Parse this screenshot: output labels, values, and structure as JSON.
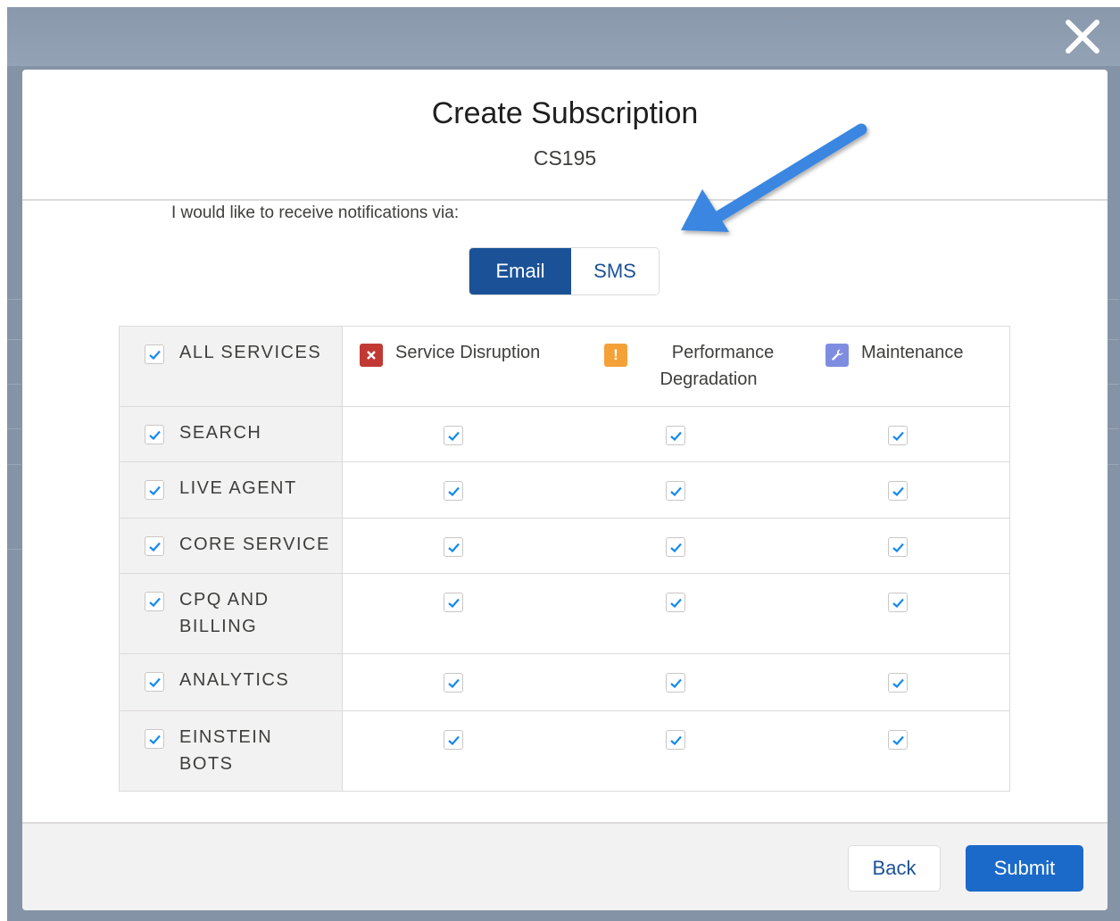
{
  "modal": {
    "title": "Create Subscription",
    "subtitle": "CS195"
  },
  "notifications": {
    "label": "I would like to receive notifications via:",
    "channels": [
      {
        "label": "Email",
        "selected": true
      },
      {
        "label": "SMS",
        "selected": false
      }
    ]
  },
  "table": {
    "all_services": {
      "label": "ALL SERVICES",
      "checked": true
    },
    "columns": [
      {
        "label": "Service Disruption",
        "icon": "close-icon",
        "icon_glyph": "✕",
        "color": "#c23934"
      },
      {
        "label": "Performance Degradation",
        "icon": "warning-icon",
        "icon_glyph": "!",
        "color": "#f4a137"
      },
      {
        "label": "Maintenance",
        "icon": "wrench-icon",
        "icon_glyph": "",
        "color": "#7f8de1"
      }
    ],
    "rows": [
      {
        "service": "SEARCH",
        "checked": true,
        "cells": [
          true,
          true,
          true
        ]
      },
      {
        "service": "LIVE AGENT",
        "checked": true,
        "cells": [
          true,
          true,
          true
        ]
      },
      {
        "service": "CORE SERVICE",
        "checked": true,
        "cells": [
          true,
          true,
          true
        ]
      },
      {
        "service": "CPQ AND BILLING",
        "checked": true,
        "cells": [
          true,
          true,
          true
        ]
      },
      {
        "service": "ANALYTICS",
        "checked": true,
        "cells": [
          true,
          true,
          true
        ]
      },
      {
        "service": "EINSTEIN BOTS",
        "checked": true,
        "cells": [
          true,
          true,
          true
        ]
      }
    ]
  },
  "footer": {
    "back_label": "Back",
    "submit_label": "Submit"
  },
  "colors": {
    "brand": "#1b5297",
    "submit": "#1b6ac9",
    "check": "#1589ee",
    "arrow": "#3a86e0"
  }
}
